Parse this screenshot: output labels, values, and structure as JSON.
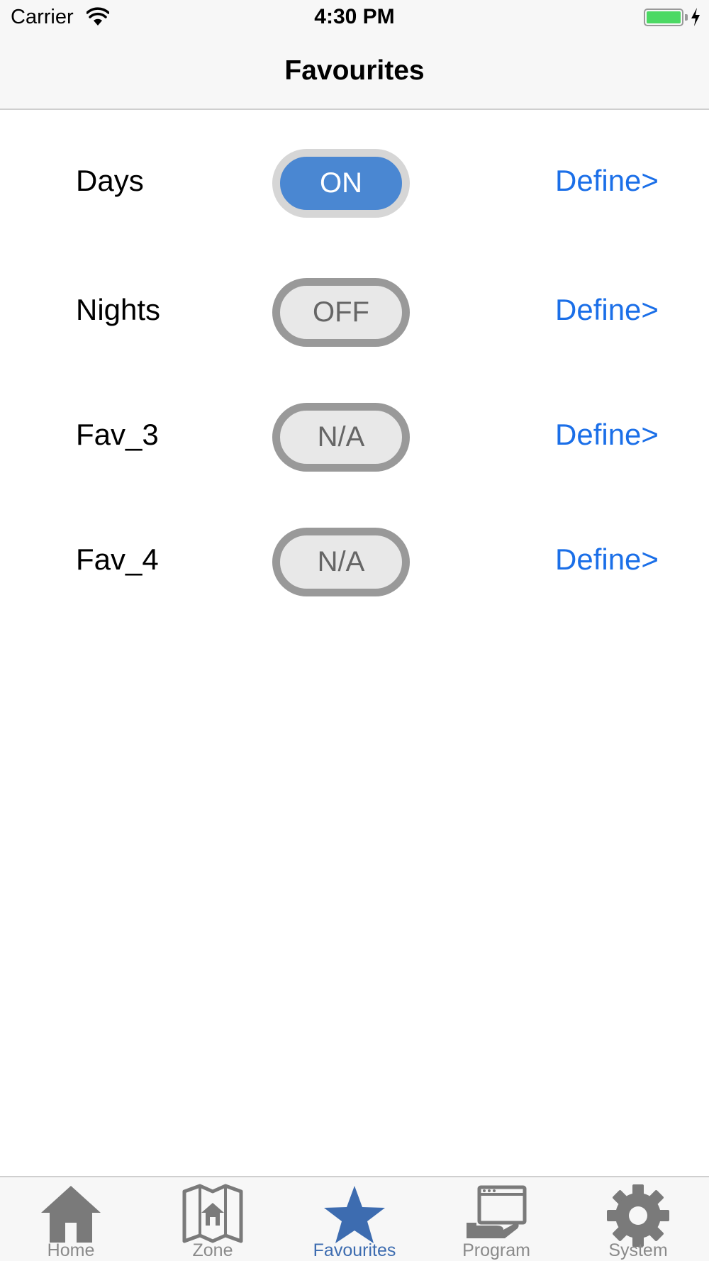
{
  "status_bar": {
    "carrier": "Carrier",
    "time": "4:30 PM",
    "battery_level": 1.0,
    "charging": true
  },
  "nav": {
    "title": "Favourites"
  },
  "favourites": [
    {
      "name": "Days",
      "state": "ON",
      "active": true,
      "define_label": "Define>"
    },
    {
      "name": "Nights",
      "state": "OFF",
      "active": false,
      "define_label": "Define>"
    },
    {
      "name": "Fav_3",
      "state": "N/A",
      "active": false,
      "define_label": "Define>"
    },
    {
      "name": "Fav_4",
      "state": "N/A",
      "active": false,
      "define_label": "Define>"
    }
  ],
  "tabs": [
    {
      "label": "Home",
      "icon": "home-icon",
      "active": false
    },
    {
      "label": "Zone",
      "icon": "zone-map-icon",
      "active": false
    },
    {
      "label": "Favourites",
      "icon": "star-icon",
      "active": true
    },
    {
      "label": "Program",
      "icon": "program-icon",
      "active": false
    },
    {
      "label": "System",
      "icon": "gear-icon",
      "active": false
    }
  ],
  "colors": {
    "toggle_on_fill": "#4a87d2",
    "toggle_off_border": "#999999",
    "link_blue": "#1b6fe8",
    "tab_active": "#3d6cb0",
    "tab_inactive": "#8a8a8a",
    "battery_green": "#4cd964"
  }
}
